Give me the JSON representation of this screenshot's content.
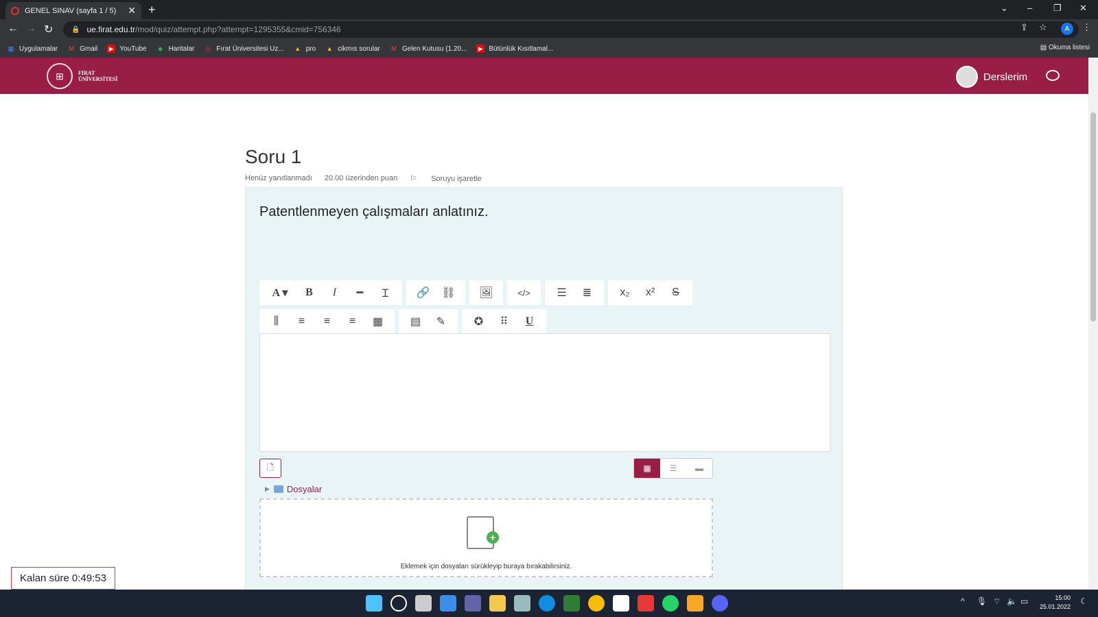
{
  "browser": {
    "tab_title": "GENEL SINAV (sayfa 1 / 5)",
    "url_host": "ue.firat.edu.tr",
    "url_path": "/mod/quiz/attempt.php?attempt=1295355&cmid=756346",
    "profile_initial": "A",
    "bookmarks": [
      "Uygulamalar",
      "Gmail",
      "YouTube",
      "Haritalar",
      "Fırat Üniversitesi Uz...",
      "pro",
      "cikmıs sorular",
      "Gelen Kutusu (1.20...",
      "Bütünlük Kısıtlamal..."
    ],
    "reading_list": "Okuma listesi"
  },
  "site": {
    "logo_line1": "FIRAT",
    "logo_line2": "ÜNİVERSİTESİ",
    "nav_courses": "Derslerim"
  },
  "question": {
    "title": "Soru 1",
    "status": "Henüz yanıtlanmadı",
    "points": "20.00 üzerinden puan",
    "flag": "Soruyu işaretle",
    "text": "Patentlenmeyen çalışmaları anlatınız."
  },
  "files": {
    "folder_label": "Dosyalar",
    "dropzone_text": "Eklemek için dosyaları sürükleyip buraya bırakabilirsiniz."
  },
  "timer": "Kalan süre 0:49:53",
  "taskbar": {
    "time": "15:00",
    "date": "25.01.2022"
  },
  "colors": {
    "brand": "#981e45",
    "question_bg": "#e8f4f6"
  }
}
